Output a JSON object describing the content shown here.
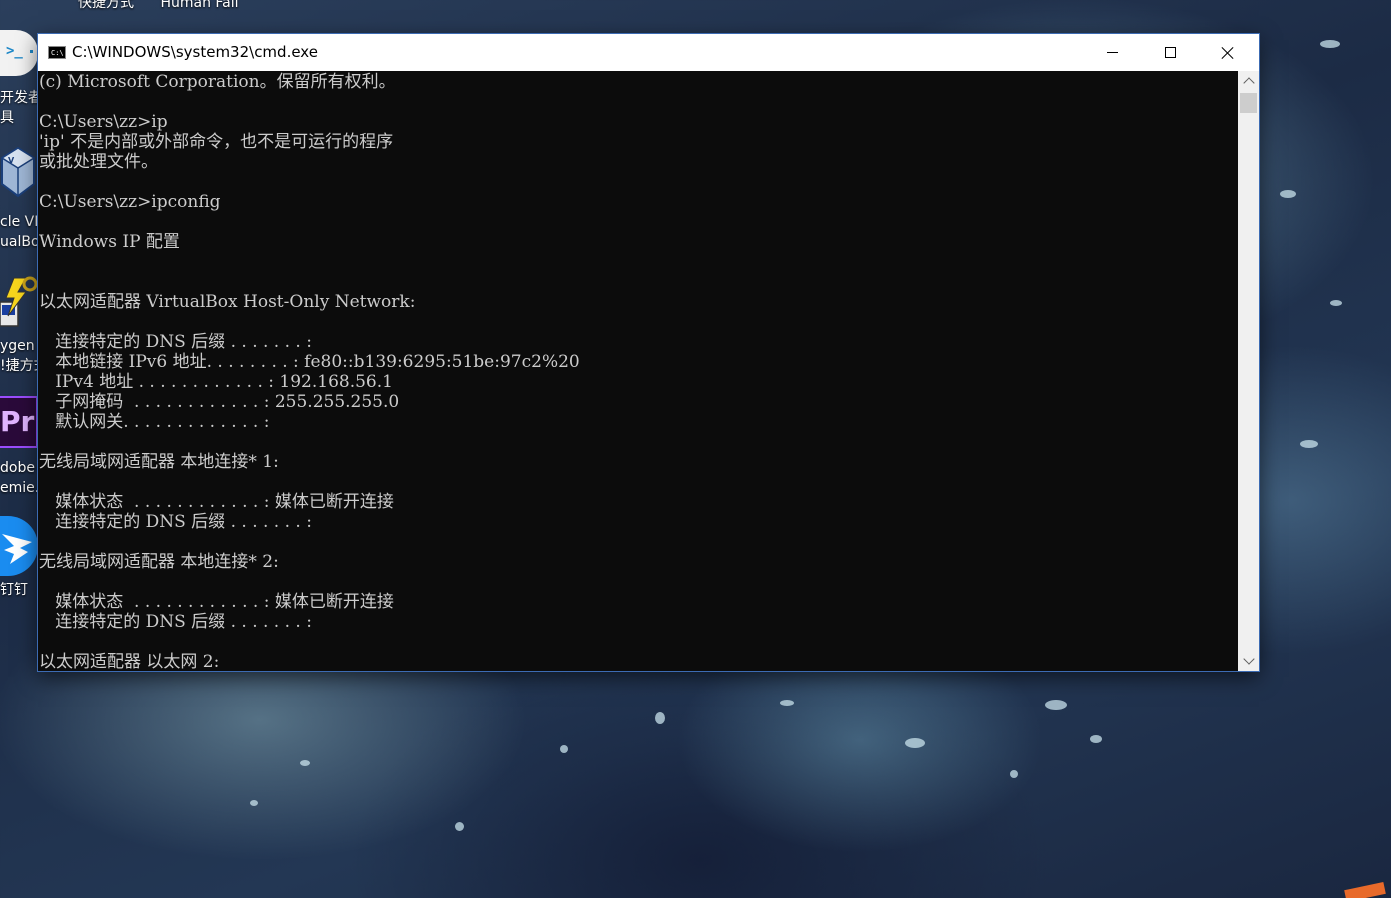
{
  "desktop": {
    "top_labels": [
      "快捷方式",
      "Human Fall"
    ],
    "icons": [
      {
        "icon": "terminal-icon",
        "label_lines": [
          "开发者",
          "具"
        ]
      },
      {
        "icon": "virtualbox-icon",
        "label_lines": [
          "cle VI",
          "ualBo"
        ]
      },
      {
        "icon": "puttygen-icon",
        "label_lines": [
          "ygen",
          "!捷方式"
        ]
      },
      {
        "icon": "premiere-icon",
        "glyph_text": "Pr",
        "label_lines": [
          "dobe",
          "emie..."
        ]
      },
      {
        "icon": "dingtalk-icon",
        "label_lines": [
          "钉钉"
        ]
      }
    ]
  },
  "window": {
    "title": "C:\\WINDOWS\\system32\\cmd.exe",
    "icon_text": "C:\\",
    "controls": [
      "minimize",
      "maximize",
      "close"
    ]
  },
  "console": {
    "lines": [
      "(c) Microsoft Corporation。保留所有权利。",
      "",
      "C:\\Users\\zz>ip",
      "'ip' 不是内部或外部命令，也不是可运行的程序",
      "或批处理文件。",
      "",
      "C:\\Users\\zz>ipconfig",
      "",
      "Windows IP 配置",
      "",
      "",
      "以太网适配器 VirtualBox Host-Only Network:",
      "",
      "   连接特定的 DNS 后缀 . . . . . . . :",
      "   本地链接 IPv6 地址. . . . . . . . : fe80::b139:6295:51be:97c2%20",
      "   IPv4 地址 . . . . . . . . . . . . : 192.168.56.1",
      "   子网掩码  . . . . . . . . . . . . : 255.255.255.0",
      "   默认网关. . . . . . . . . . . . . :",
      "",
      "无线局域网适配器 本地连接* 1:",
      "",
      "   媒体状态  . . . . . . . . . . . . : 媒体已断开连接",
      "   连接特定的 DNS 后缀 . . . . . . . :",
      "",
      "无线局域网适配器 本地连接* 2:",
      "",
      "   媒体状态  . . . . . . . . . . . . : 媒体已断开连接",
      "   连接特定的 DNS 后缀 . . . . . . . :",
      "",
      "以太网适配器 以太网 2:"
    ]
  },
  "colors": {
    "console_bg": "#0c0c0c",
    "console_text": "#cccccc",
    "titlebar_bg": "#ffffff"
  }
}
